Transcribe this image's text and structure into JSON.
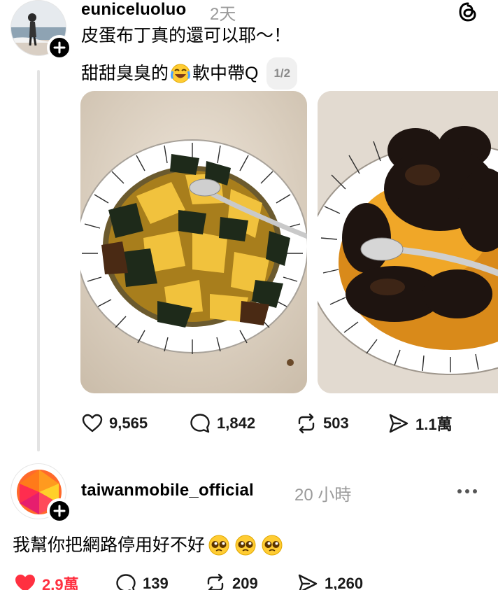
{
  "post": {
    "username": "euniceluoluo",
    "time": "2天",
    "line1": "皮蛋布丁真的還可以耶～！",
    "line2_before": "甜甜臭臭的",
    "line2_after": "軟中帶Q",
    "image_counter": "1/2",
    "likes": "9,565",
    "comments": "1,842",
    "reposts": "503",
    "shares": "1.1萬"
  },
  "reply": {
    "username": "taiwanmobile_official",
    "time": "20 小時",
    "text": "我幫你把網路停用好不好",
    "likes": "2.9萬",
    "comments": "139",
    "reposts": "209",
    "shares": "1,260"
  },
  "colors": {
    "liked_red": "#ff3040",
    "muted": "#9a9a9a",
    "thread_line": "#e3e3e3"
  },
  "icons": [
    "threads-logo-icon",
    "plus-icon",
    "heart-icon",
    "comment-icon",
    "repost-icon",
    "share-icon",
    "more-icon"
  ]
}
